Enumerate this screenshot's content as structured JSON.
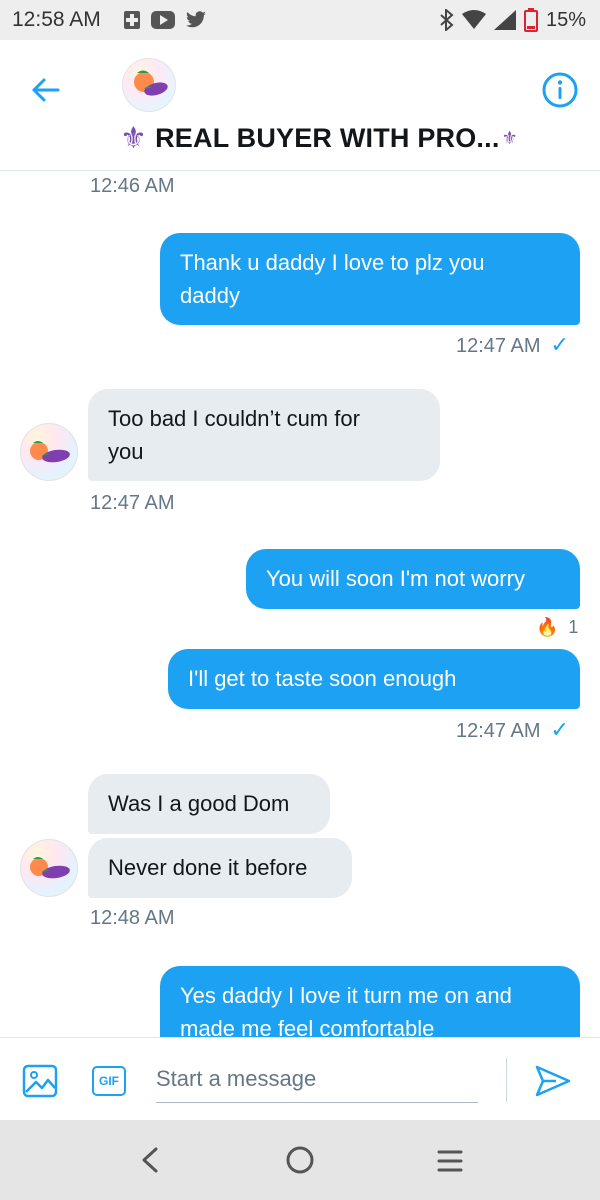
{
  "status_bar": {
    "time": "12:58 AM",
    "battery_pct": "15%"
  },
  "header": {
    "title": "REAL BUYER WITH PRO...",
    "back_icon": "arrow-left-icon",
    "info_icon": "info-circle-icon"
  },
  "messages": [
    {
      "ts": "12:46 AM"
    },
    {
      "dir": "out",
      "text_lines": [
        "Thank u daddy I love to plz you",
        "daddy"
      ],
      "ts": "12:47 AM"
    },
    {
      "dir": "in",
      "text_lines": [
        "Too bad I couldn’t cum for",
        "you"
      ],
      "ts": "12:47 AM"
    },
    {
      "dir": "out",
      "text_lines": [
        "You will soon I'm not worry"
      ],
      "reaction": "1"
    },
    {
      "dir": "out",
      "text_lines": [
        "I'll get to taste soon enough"
      ],
      "ts": "12:47 AM"
    },
    {
      "dir": "in",
      "text_lines": [
        "Was I a good Dom"
      ]
    },
    {
      "dir": "in",
      "text_lines": [
        "Never done it before"
      ],
      "ts": "12:48 AM"
    },
    {
      "dir": "out",
      "text_lines": [
        "Yes daddy I love it turn me on and",
        "made me feel comfortable"
      ]
    }
  ],
  "composer": {
    "placeholder": "Start a message",
    "gif_label": "GIF"
  },
  "colors": {
    "accent": "#1da1f2",
    "incoming_bubble": "#e6ecf0",
    "timestamp": "#657786"
  }
}
